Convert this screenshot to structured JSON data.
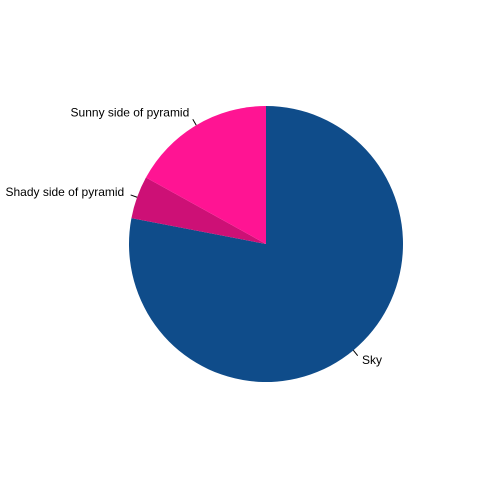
{
  "chart_data": {
    "type": "pie",
    "title": "",
    "start": "top",
    "direction": "clockwise",
    "slices": [
      {
        "label": "Sky",
        "value": 78,
        "color": "#0f4c8a"
      },
      {
        "label": "Shady side of pyramid",
        "value": 5,
        "color": "#cd1076"
      },
      {
        "label": "Sunny side of pyramid",
        "value": 17,
        "color": "#ff1493"
      }
    ]
  }
}
